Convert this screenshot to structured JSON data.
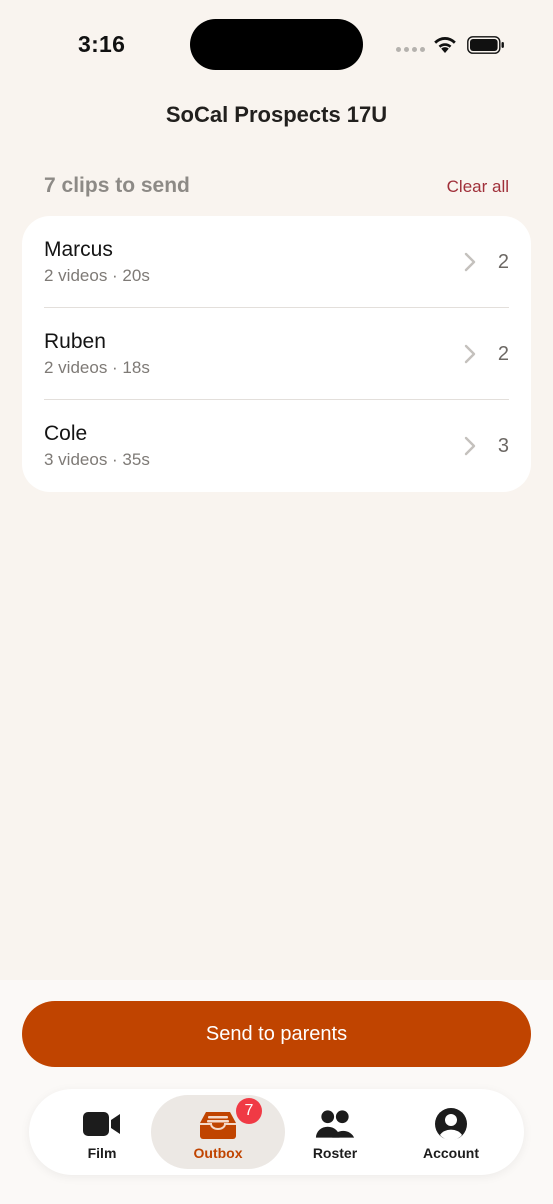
{
  "status_bar": {
    "time": "3:16"
  },
  "header": {
    "title": "SoCal Prospects 17U"
  },
  "outbox": {
    "section_title": "7 clips to send",
    "clear_all_label": "Clear all",
    "players": [
      {
        "name": "Marcus",
        "summary": "2 videos · 20s",
        "count": "2"
      },
      {
        "name": "Ruben",
        "summary": "2 videos · 18s",
        "count": "2"
      },
      {
        "name": "Cole",
        "summary": "3 videos · 35s",
        "count": "3"
      }
    ]
  },
  "actions": {
    "send_label": "Send to parents"
  },
  "tab_bar": {
    "tabs": [
      {
        "label": "Film",
        "icon": "video-camera-icon"
      },
      {
        "label": "Outbox",
        "icon": "inbox-tray-icon",
        "badge": "7",
        "active": true
      },
      {
        "label": "Roster",
        "icon": "people-icon"
      },
      {
        "label": "Account",
        "icon": "person-circle-icon"
      }
    ]
  },
  "colors": {
    "accent": "#c04400",
    "destructive": "#a0303a",
    "badge": "#f03a45",
    "background": "#f9f4ef"
  }
}
